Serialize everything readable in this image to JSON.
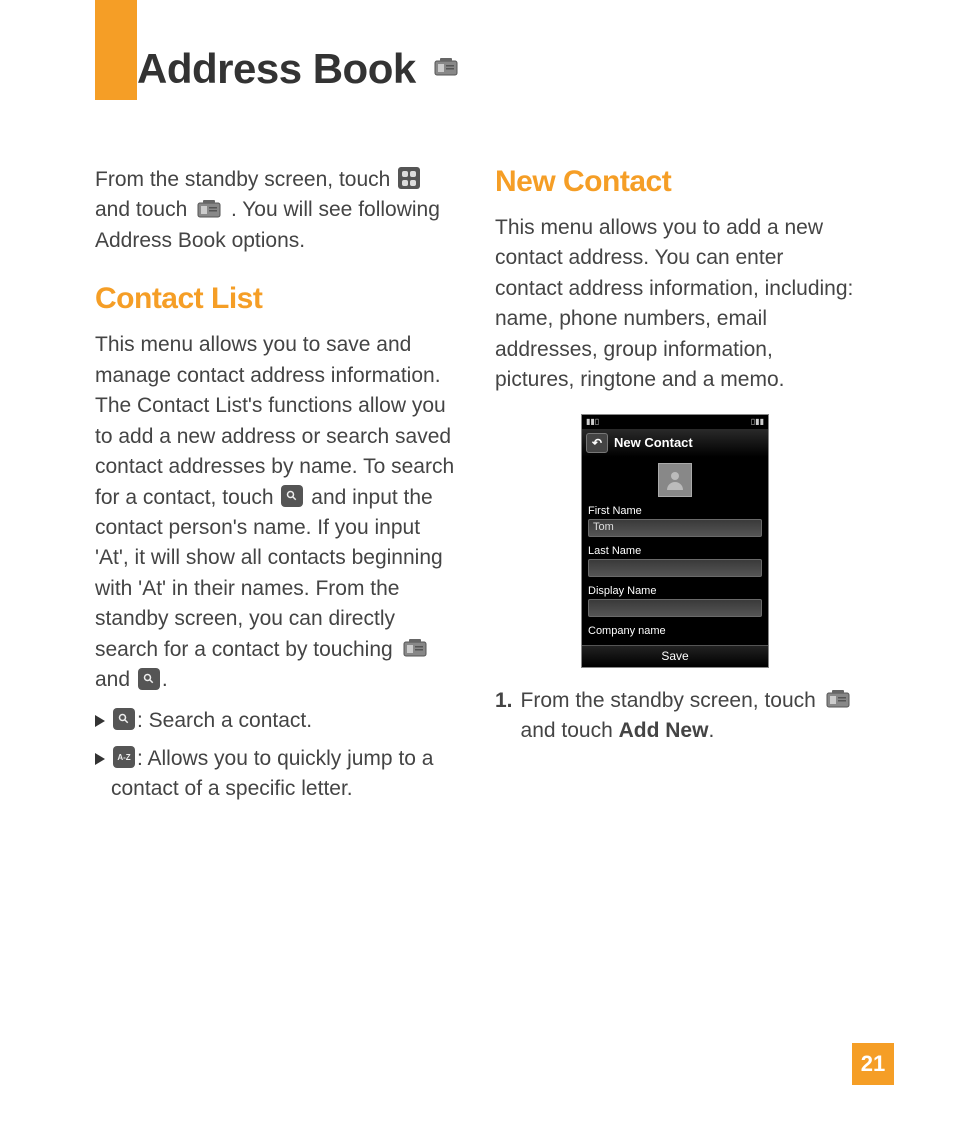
{
  "page": {
    "title": "Address Book",
    "number": "21"
  },
  "intro": {
    "part1": "From the standby screen, touch",
    "part2": "and touch",
    "part3": ". You will see following Address Book options."
  },
  "sections": {
    "contact_list": {
      "heading": "Contact List",
      "body1": "This menu allows you to save and manage contact address information. The Contact List's functions allow you to add a new address or search saved contact addresses by name. To search for a contact, touch",
      "body2": "and input the contact person's name. If you input 'At', it will show all contacts beginning with 'At' in their names. From the standby screen, you can directly search for a contact by touching",
      "body3": "and",
      "body4": ".",
      "bullets": [
        ": Search a contact.",
        ": Allows you to quickly jump to a contact of a specific letter."
      ]
    },
    "new_contact": {
      "heading": "New Contact",
      "body": "This menu allows you to add a new contact address. You can enter contact address information, including: name, phone numbers, email addresses, group information, pictures, ringtone and a memo.",
      "step1_a": "From the standby screen, touch",
      "step1_b": "and touch",
      "step1_bold": "Add New",
      "step1_c": "."
    }
  },
  "phone": {
    "header": "New Contact",
    "labels": {
      "first_name": "First Name",
      "last_name": "Last Name",
      "display_name": "Display Name",
      "company_name": "Company name"
    },
    "values": {
      "first_name": "Tom",
      "last_name": "",
      "display_name": "",
      "company_name": ""
    },
    "save": "Save"
  }
}
